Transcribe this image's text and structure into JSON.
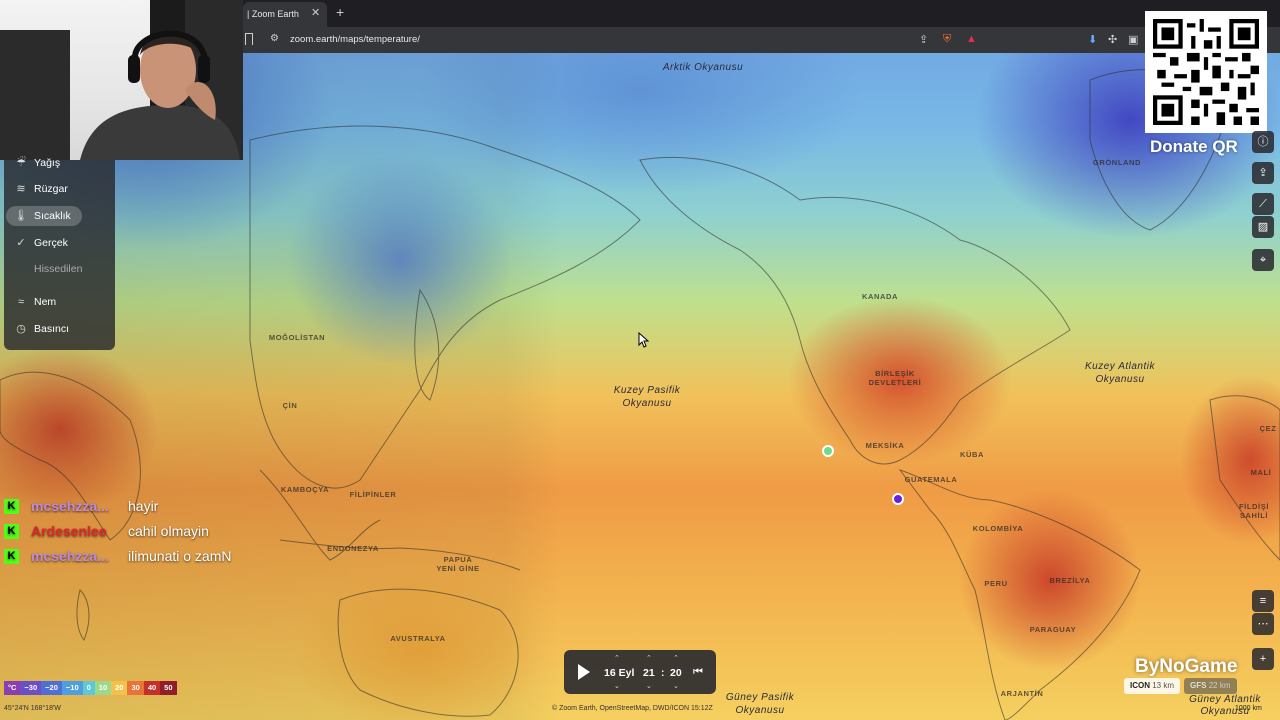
{
  "browser": {
    "tab_title": "| Zoom Earth",
    "tab_close": "✕",
    "new_tab": "+",
    "url": "zoom.earth/maps/temperature/"
  },
  "qr": {
    "label": "Donate QR"
  },
  "layer_menu": {
    "items": [
      {
        "label": "Yağış",
        "icon": "rain-icon",
        "glyph": "☔",
        "active": false,
        "dim": false
      },
      {
        "label": "Rüzgar",
        "icon": "wind-icon",
        "glyph": "≋",
        "active": false,
        "dim": false
      },
      {
        "label": "Sıcaklık",
        "icon": "thermometer-icon",
        "glyph": "🌡",
        "active": true,
        "dim": false
      },
      {
        "label": "Gerçek",
        "icon": "check-icon",
        "glyph": "✓",
        "active": false,
        "dim": false
      },
      {
        "label": "Hissedilen",
        "icon": "",
        "glyph": "",
        "active": false,
        "dim": true
      },
      {
        "label": "Nem",
        "icon": "humidity-icon",
        "glyph": "≈",
        "active": false,
        "dim": false
      },
      {
        "label": "Basıncı",
        "icon": "gauge-icon",
        "glyph": "◷",
        "active": false,
        "dim": false
      }
    ]
  },
  "map_labels": {
    "arctic": "Arktik Okyanusu",
    "north_pacific_1": "Kuzey Pasifik",
    "north_pacific_2": "Okyanusu",
    "north_atlantic_1": "Kuzey Atlantik",
    "north_atlantic_2": "Okyanusu",
    "south_pacific_1": "Güney Pasifik",
    "south_pacific_2": "Okyanusu",
    "south_atlantic_1": "Güney Atlantik",
    "south_atlantic_2": "Okyanusu"
  },
  "country_labels": {
    "greenland": "GRÖNLAND",
    "canada": "KANADA",
    "usa_1": "BİRLEŞİK",
    "usa_2": "DEVLETLERİ",
    "mexico": "MEKSİKA",
    "cuba": "KÜBA",
    "guatemala": "GUATEMALA",
    "colombia": "KOLOMBİYA",
    "peru": "PERU",
    "brazil": "BREZİLYA",
    "paraguay": "PARAGUAY",
    "argentina": "ARJANTİN",
    "mongolia": "MOĞOLİSTAN",
    "china": "ÇİN",
    "cambodia": "KAMBOÇYA",
    "philippines": "FİLİPİNLER",
    "indonesia": "ENDONEZYA",
    "papua_1": "PAPUA",
    "papua_2": "YENİ GİNE",
    "australia": "AVUSTRALYA",
    "mali": "MALİ",
    "ivory_coast_1": "FİLDİŞİ",
    "ivory_coast_2": "SAHİLİ",
    "cez": "ÇEZ"
  },
  "chat": [
    {
      "user": "mcsehzza...",
      "user_color": "#c08ad8",
      "message": "hayir"
    },
    {
      "user": "Ardesenlee",
      "user_color": "#e0262b",
      "message": "cahil olmayin"
    },
    {
      "user": "mcsehzza...",
      "user_color": "#c08ad8",
      "message": "ilimunati o zamN"
    }
  ],
  "chat_badge": "K",
  "timeline": {
    "date": "16 Eyl",
    "hour": "21",
    "separator": ":",
    "minute": "20"
  },
  "legend": {
    "unit": "°C",
    "values": [
      "−30",
      "−20",
      "−10",
      "0",
      "10",
      "20",
      "30",
      "40",
      "50"
    ],
    "colors": [
      "#8a3fb0",
      "#6a4fc8",
      "#4f6fd6",
      "#4f9ee0",
      "#5fc8d8",
      "#9ed88a",
      "#f2c24a",
      "#e8743a",
      "#c23228",
      "#8e1f2a"
    ]
  },
  "coords": "45°24'N 168°18'W",
  "attribution": "© Zoom Earth, OpenStreetMap, DWD/ICON 15:12Z",
  "models": [
    {
      "name": "ICON",
      "res": "13 km",
      "selected": true
    },
    {
      "name": "GFS",
      "res": "22 km",
      "selected": false
    }
  ],
  "watermark": "ByNoGame",
  "scale": "1000 km"
}
